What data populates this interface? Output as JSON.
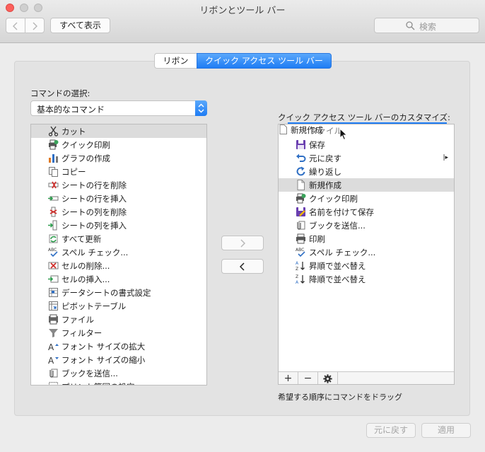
{
  "window": {
    "title": "リボンとツール バー"
  },
  "toolbar": {
    "show_all": "すべて表示",
    "search_placeholder": "検索"
  },
  "tabs": [
    {
      "label": "リボン",
      "active": false
    },
    {
      "label": "クイック アクセス ツール バー",
      "active": true
    }
  ],
  "left": {
    "label": "コマンドの選択:",
    "dropdown_value": "基本的なコマンド",
    "items": [
      {
        "label": "カット",
        "icon": "scissors-icon",
        "selected": true
      },
      {
        "label": "クイック印刷",
        "icon": "quick-print-icon"
      },
      {
        "label": "グラフの作成",
        "icon": "chart-icon"
      },
      {
        "label": "コピー",
        "icon": "copy-icon"
      },
      {
        "label": "シートの行を削除",
        "icon": "delete-row-icon"
      },
      {
        "label": "シートの行を挿入",
        "icon": "insert-row-icon"
      },
      {
        "label": "シートの列を削除",
        "icon": "delete-column-icon"
      },
      {
        "label": "シートの列を挿入",
        "icon": "insert-column-icon"
      },
      {
        "label": "すべて更新",
        "icon": "refresh-all-icon"
      },
      {
        "label": "スペル チェック...",
        "icon": "spell-check-icon"
      },
      {
        "label": "セルの削除...",
        "icon": "delete-cells-icon"
      },
      {
        "label": "セルの挿入...",
        "icon": "insert-cells-icon"
      },
      {
        "label": "データシートの書式設定",
        "icon": "datasheet-format-icon"
      },
      {
        "label": "ピボットテーブル",
        "icon": "pivot-table-icon"
      },
      {
        "label": "ファイル",
        "icon": "file-icon"
      },
      {
        "label": "フィルター",
        "icon": "filter-icon"
      },
      {
        "label": "フォント サイズの拡大",
        "icon": "font-grow-icon"
      },
      {
        "label": "フォント サイズの縮小",
        "icon": "font-shrink-icon"
      },
      {
        "label": "ブックを送信...",
        "icon": "send-workbook-icon"
      },
      {
        "label": "プリント範囲の設定",
        "icon": "print-area-icon"
      }
    ]
  },
  "right": {
    "label": "クイック アクセス ツール バーのカスタマイズ:",
    "drag_ghost_label": "新規作成",
    "drag_under_text": "ファイル",
    "items": [
      {
        "label": "保存",
        "icon": "save-icon"
      },
      {
        "label": "元に戻す",
        "icon": "undo-icon",
        "has_submenu": true
      },
      {
        "label": "繰り返し",
        "icon": "redo-icon"
      },
      {
        "label": "新規作成",
        "icon": "new-document-icon",
        "selected": true
      },
      {
        "label": "クイック印刷",
        "icon": "quick-print-icon"
      },
      {
        "label": "名前を付けて保存",
        "icon": "save-as-icon"
      },
      {
        "label": "ブックを送信...",
        "icon": "send-workbook-icon"
      },
      {
        "label": "印刷",
        "icon": "print-icon"
      },
      {
        "label": "スペル チェック...",
        "icon": "spell-check-icon"
      },
      {
        "label": "昇順で並べ替え",
        "icon": "sort-ascending-icon"
      },
      {
        "label": "降順で並べ替え",
        "icon": "sort-descending-icon"
      }
    ],
    "hint": "希望する順序にコマンドをドラッグ"
  },
  "controls": {
    "add": "+",
    "remove": "−"
  },
  "footer": {
    "revert": "元に戻す",
    "apply": "適用"
  },
  "colors": {
    "accent": "#1e7cf4",
    "close": "#fc605c"
  }
}
